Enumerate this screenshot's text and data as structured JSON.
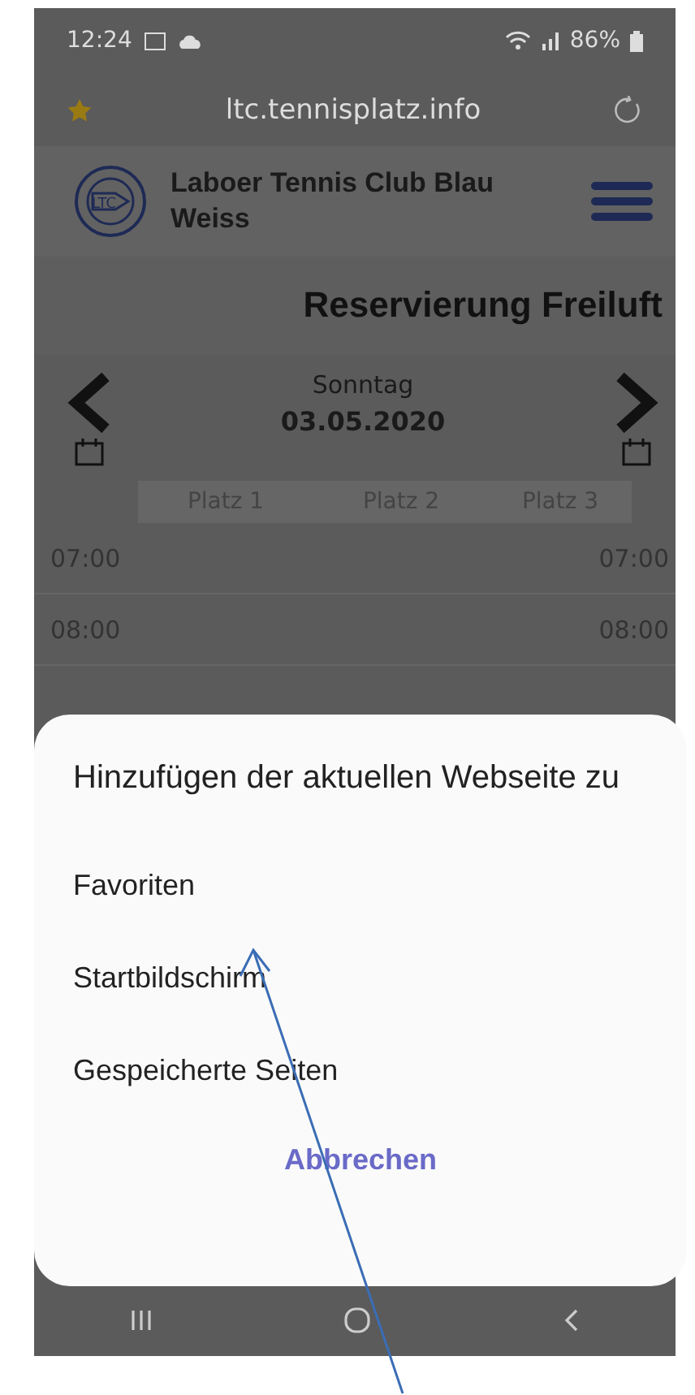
{
  "status_bar": {
    "time": "12:24",
    "battery": "86%"
  },
  "address_bar": {
    "url": "ltc.tennisplatz.info",
    "bookmarked": true
  },
  "site_header": {
    "title": "Laboer Tennis Club Blau Weiss",
    "logo_text": "LTC"
  },
  "page_title": "Reservierung Freiluft",
  "date_nav": {
    "weekday": "Sonntag",
    "date": "03.05.2020"
  },
  "table": {
    "columns": [
      "Platz 1",
      "Platz 2",
      "Platz 3"
    ],
    "rows": [
      {
        "time_left": "07:00",
        "time_right": "07:00"
      },
      {
        "time_left": "08:00",
        "time_right": "08:00"
      }
    ]
  },
  "dialog": {
    "title": "Hinzufügen der aktuellen Webseite zu",
    "options": [
      "Favoriten",
      "Startbildschirm",
      "Gespeicherte Seiten"
    ],
    "cancel": "Abbrechen"
  }
}
